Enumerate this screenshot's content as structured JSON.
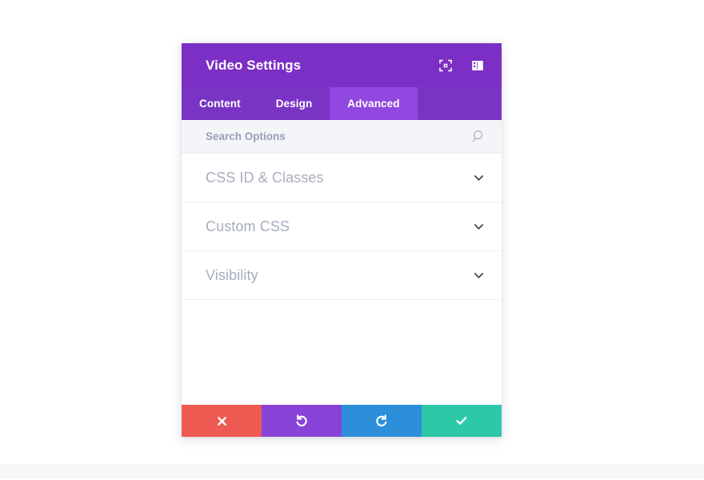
{
  "modal": {
    "header": {
      "title": "Video Settings",
      "actions": [
        {
          "name": "focus-target-icon",
          "tooltip": "Focus"
        },
        {
          "name": "layout-panel-icon",
          "tooltip": "Layout"
        }
      ]
    },
    "tabs": [
      {
        "label": "Content",
        "active": false
      },
      {
        "label": "Design",
        "active": false
      },
      {
        "label": "Advanced",
        "active": true
      }
    ],
    "search": {
      "placeholder": "Search Options",
      "value": "",
      "icon": "search-icon"
    },
    "sections": [
      {
        "label": "CSS ID & Classes",
        "expanded": false,
        "icon": "chevron-down-icon"
      },
      {
        "label": "Custom CSS",
        "expanded": false,
        "icon": "chevron-down-icon"
      },
      {
        "label": "Visibility",
        "expanded": false,
        "icon": "chevron-down-icon"
      }
    ],
    "footer": [
      {
        "name": "cancel-button",
        "icon": "close-x-icon",
        "color": "#ee5a52"
      },
      {
        "name": "undo-button",
        "icon": "undo-arrow-icon",
        "color": "#8843d9"
      },
      {
        "name": "redo-button",
        "icon": "redo-arrow-icon",
        "color": "#2d8eda"
      },
      {
        "name": "save-button",
        "icon": "checkmark-icon",
        "color": "#2cc8a8"
      }
    ]
  },
  "colors": {
    "header_purple": "#7b2fc4",
    "tabbar_purple": "#7a34c4",
    "active_tab_purple": "#9248e0",
    "search_bg": "#f4f5f9",
    "label_gray": "#a9aebf",
    "cancel_red": "#ee5a52",
    "undo_purple": "#8843d9",
    "redo_blue": "#2d8eda",
    "save_teal": "#2cc8a8"
  }
}
